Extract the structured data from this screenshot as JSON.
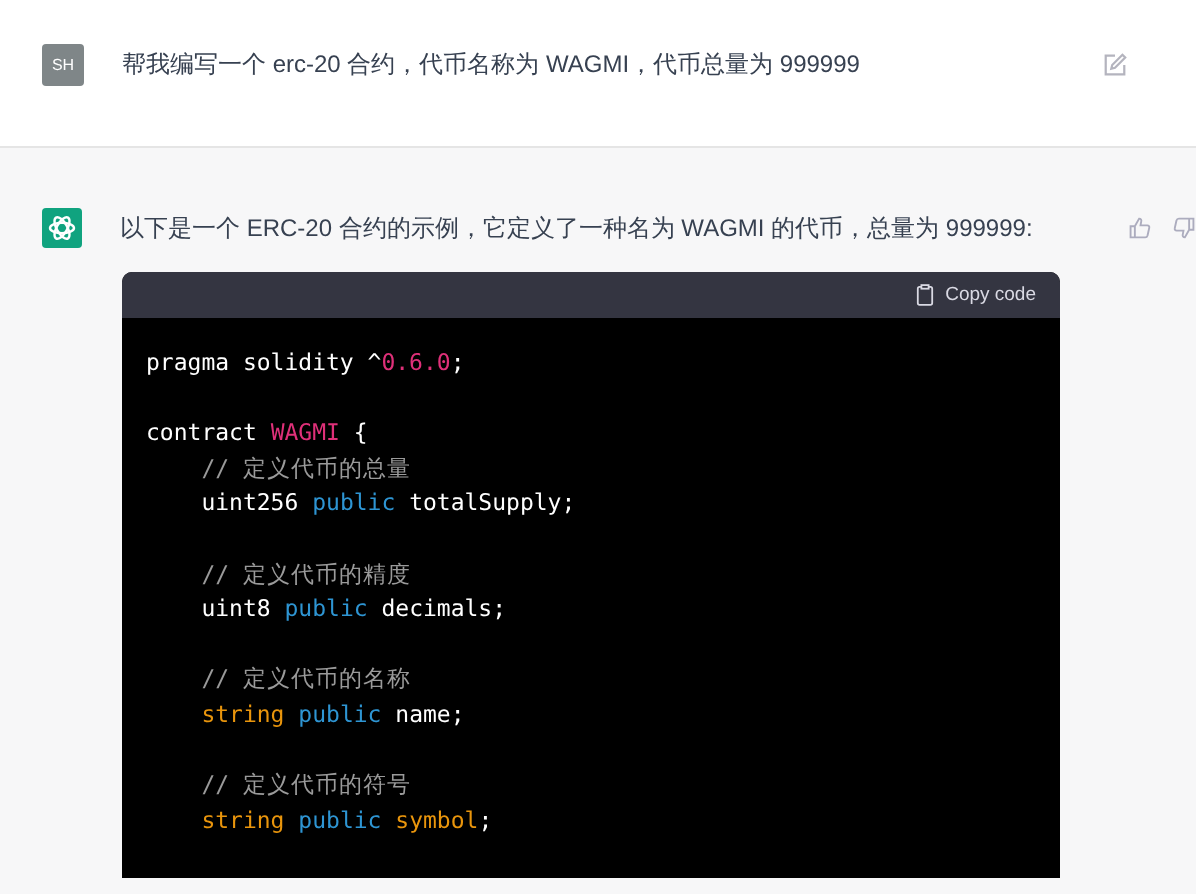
{
  "messages": [
    {
      "kind": "user",
      "avatar": "SH",
      "text": "帮我编写一个 erc-20 合约，代币名称为  WAGMI，代币总量为 999999"
    },
    {
      "kind": "assistant",
      "text": "以下是一个 ERC-20 合约的示例，它定义了一种名为 WAGMI 的代币，总量为 999999:"
    }
  ],
  "code_block": {
    "copy_label": "Copy code",
    "lines": [
      {
        "kind": "code",
        "tokens": [
          {
            "kind": "plain",
            "text": "pragma solidity ^"
          },
          {
            "kind": "literal",
            "text": "0.6.0"
          },
          {
            "kind": "plain",
            "text": ";"
          }
        ]
      },
      {
        "kind": "blank"
      },
      {
        "kind": "code",
        "tokens": [
          {
            "kind": "plain",
            "text": "contract "
          },
          {
            "kind": "literal",
            "text": "WAGMI"
          },
          {
            "kind": "plain",
            "text": " {"
          }
        ]
      },
      {
        "kind": "code",
        "tokens": [
          {
            "kind": "comment",
            "text": "    // 定义代币的总量"
          }
        ]
      },
      {
        "kind": "code",
        "tokens": [
          {
            "kind": "plain",
            "text": "    uint256 "
          },
          {
            "kind": "keyword",
            "text": "public"
          },
          {
            "kind": "plain",
            "text": " totalSupply;"
          }
        ]
      },
      {
        "kind": "blank"
      },
      {
        "kind": "code",
        "tokens": [
          {
            "kind": "comment",
            "text": "    // 定义代币的精度"
          }
        ]
      },
      {
        "kind": "code",
        "tokens": [
          {
            "kind": "plain",
            "text": "    uint8 "
          },
          {
            "kind": "keyword",
            "text": "public"
          },
          {
            "kind": "plain",
            "text": " decimals;"
          }
        ]
      },
      {
        "kind": "blank"
      },
      {
        "kind": "code",
        "tokens": [
          {
            "kind": "comment",
            "text": "    // 定义代币的名称"
          }
        ]
      },
      {
        "kind": "code",
        "tokens": [
          {
            "kind": "type",
            "text": "    string "
          },
          {
            "kind": "keyword",
            "text": "public"
          },
          {
            "kind": "plain",
            "text": " name;"
          }
        ]
      },
      {
        "kind": "blank"
      },
      {
        "kind": "code",
        "tokens": [
          {
            "kind": "comment",
            "text": "    // 定义代币的符号"
          }
        ]
      },
      {
        "kind": "code",
        "tokens": [
          {
            "kind": "type",
            "text": "    string "
          },
          {
            "kind": "keyword",
            "text": "public "
          },
          {
            "kind": "type",
            "text": "symbol"
          },
          {
            "kind": "plain",
            "text": ";"
          }
        ]
      }
    ]
  }
}
